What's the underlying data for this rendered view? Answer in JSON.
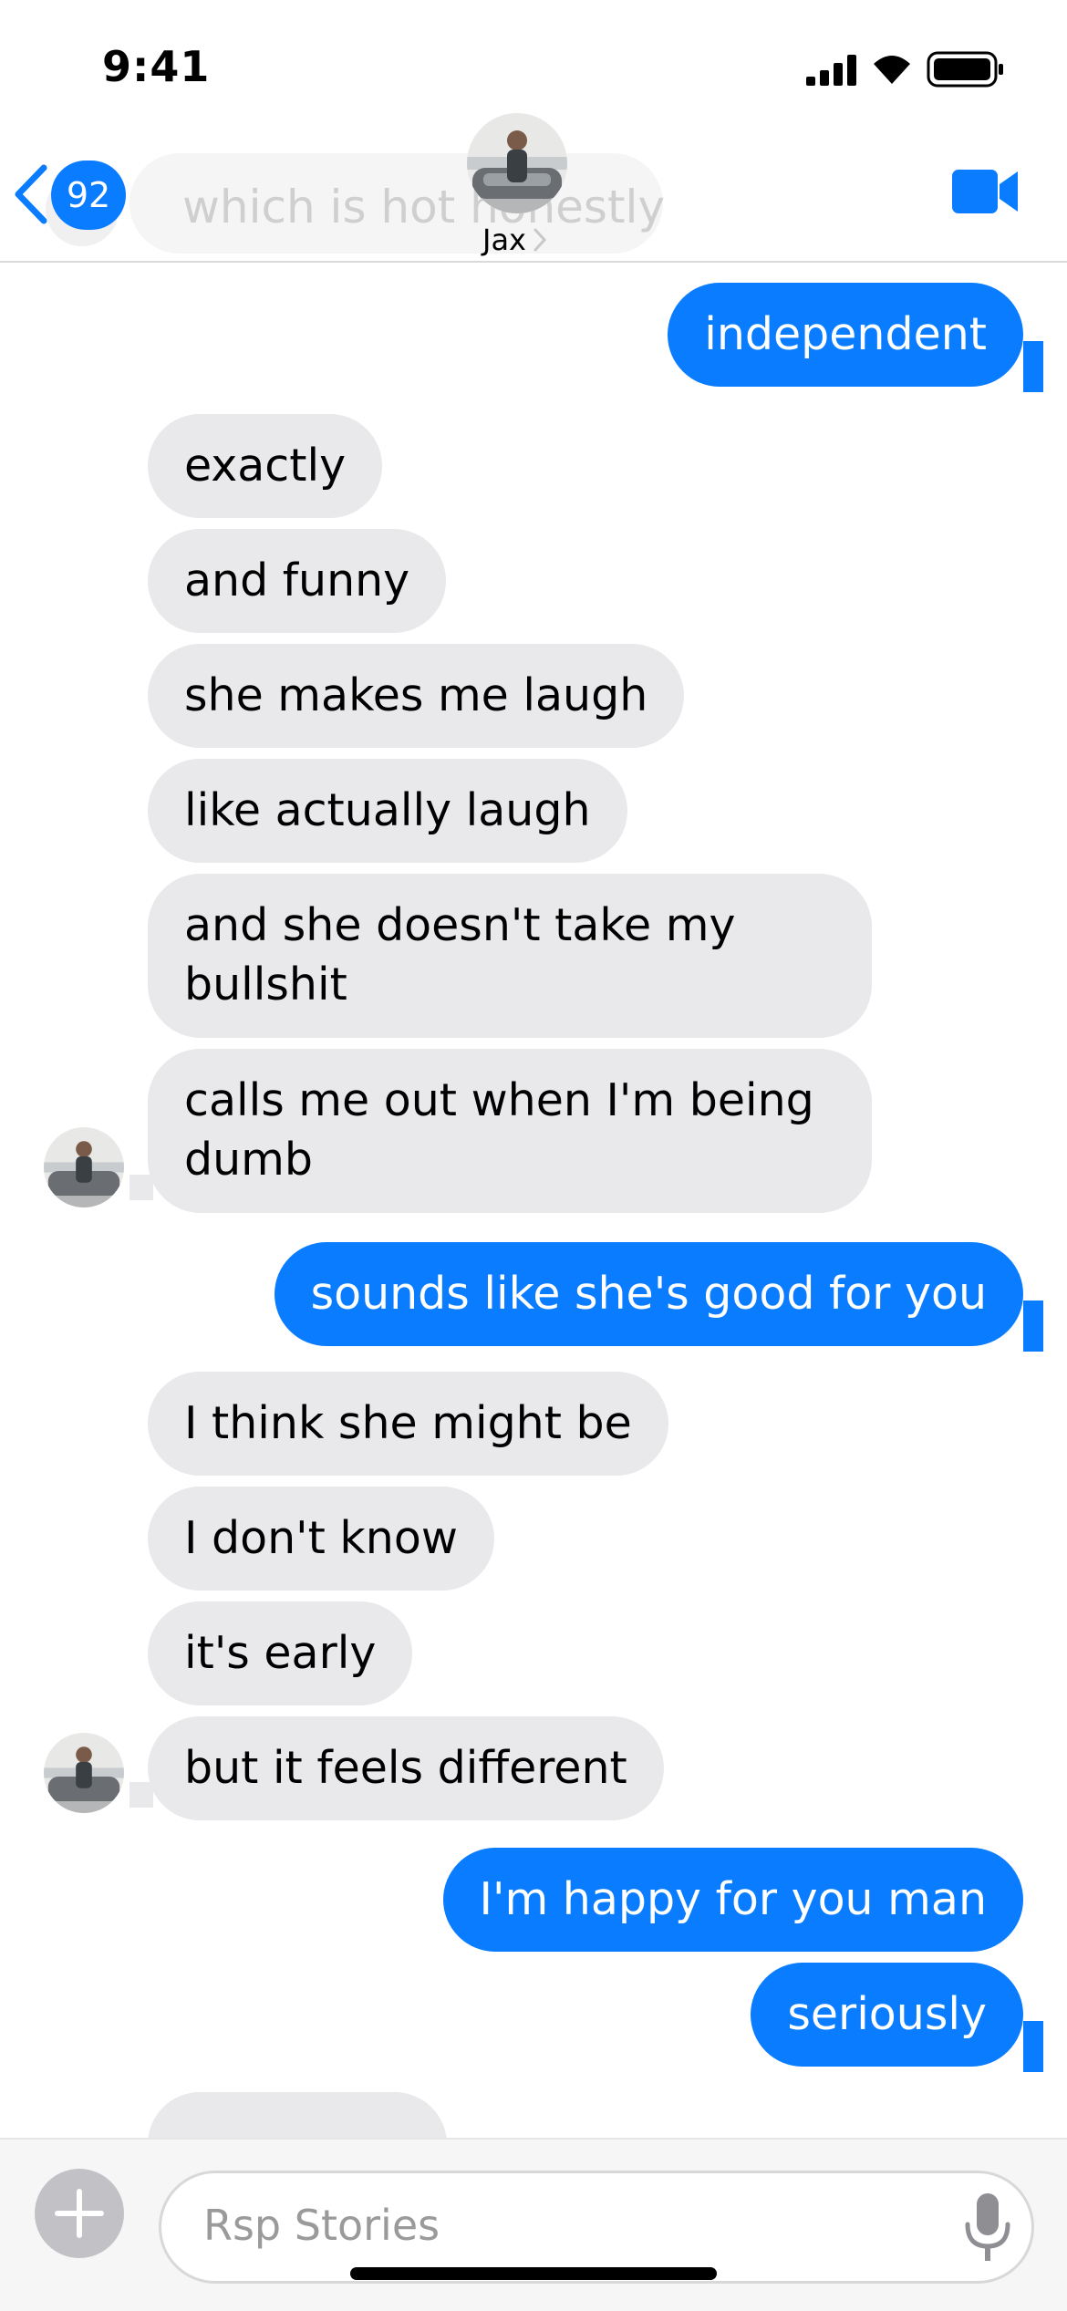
{
  "status_bar": {
    "time": "9:41"
  },
  "header": {
    "back_badge_count": "92",
    "contact_name": "Jax",
    "ghost_preview_text": "which is hot honestly"
  },
  "messages": [
    {
      "from": "me",
      "text": "independent"
    },
    {
      "from": "jax",
      "text": "exactly"
    },
    {
      "from": "jax",
      "text": "and funny"
    },
    {
      "from": "jax",
      "text": "she makes me laugh"
    },
    {
      "from": "jax",
      "text": "like actually laugh"
    },
    {
      "from": "jax",
      "text": "and she doesn't take my\nbullshit"
    },
    {
      "from": "jax",
      "text": "calls me out when I'm being\ndumb"
    },
    {
      "from": "me",
      "text": "sounds like she's good for you"
    },
    {
      "from": "jax",
      "text": "I think she might be"
    },
    {
      "from": "jax",
      "text": "I don't know"
    },
    {
      "from": "jax",
      "text": "it's early"
    },
    {
      "from": "jax",
      "text": "but it feels different"
    },
    {
      "from": "me",
      "text": "I'm happy for you man"
    },
    {
      "from": "me",
      "text": "seriously"
    }
  ],
  "composer": {
    "placeholder": "Rsp Stories"
  },
  "colors": {
    "accent": "#0a7cff",
    "received_bubble": "#e9e9eb"
  }
}
